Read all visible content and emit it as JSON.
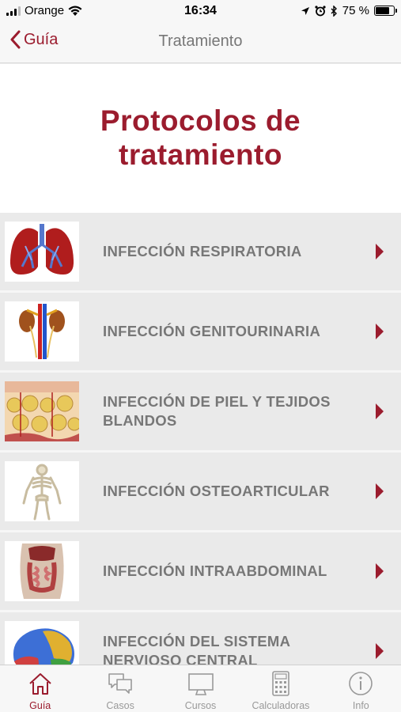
{
  "status_bar": {
    "carrier": "Orange",
    "time": "16:34",
    "battery_pct": "75 %",
    "battery_level": 0.75
  },
  "nav": {
    "back_label": "Guía",
    "title": "Tratamiento"
  },
  "header": {
    "title": "Protocolos de tratamiento"
  },
  "list": {
    "items": [
      {
        "label": "INFECCIÓN RESPIRATORIA",
        "icon": "lungs-icon"
      },
      {
        "label": "INFECCIÓN GENITOURINARIA",
        "icon": "kidneys-icon"
      },
      {
        "label": "INFECCIÓN DE PIEL Y TEJIDOS BLANDOS",
        "icon": "skin-tissue-icon"
      },
      {
        "label": "INFECCIÓN OSTEOARTICULAR",
        "icon": "skeleton-icon"
      },
      {
        "label": "INFECCIÓN INTRAABDOMINAL",
        "icon": "abdomen-icon"
      },
      {
        "label": "INFECCIÓN DEL SISTEMA NERVIOSO CENTRAL",
        "icon": "brain-icon"
      }
    ]
  },
  "tabs": [
    {
      "label": "Guía",
      "icon": "home-icon",
      "active": true
    },
    {
      "label": "Casos",
      "icon": "chat-bubbles-icon",
      "active": false
    },
    {
      "label": "Cursos",
      "icon": "monitor-icon",
      "active": false
    },
    {
      "label": "Calculadoras",
      "icon": "calculator-icon",
      "active": false
    },
    {
      "label": "Info",
      "icon": "info-icon",
      "active": false
    }
  ],
  "colors": {
    "accent": "#9b1c2e",
    "muted_text": "#777777",
    "list_bg": "#eaeaea"
  }
}
